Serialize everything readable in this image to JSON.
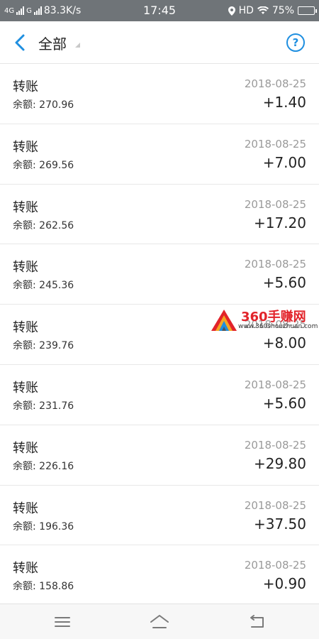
{
  "status_bar": {
    "network_1": "4G",
    "network_2": "G",
    "speed": "83.3K/s",
    "time": "17:45",
    "hd": "HD",
    "battery": "75%",
    "battery_level": 0.75
  },
  "header": {
    "title": "全部",
    "help_symbol": "?",
    "accent_color": "#1f8fe0"
  },
  "transactions": [
    {
      "title": "转账",
      "balance": "余额: 270.96",
      "date": "2018-08-25",
      "amount": "+1.40"
    },
    {
      "title": "转账",
      "balance": "余额: 269.56",
      "date": "2018-08-25",
      "amount": "+7.00"
    },
    {
      "title": "转账",
      "balance": "余额: 262.56",
      "date": "2018-08-25",
      "amount": "+17.20"
    },
    {
      "title": "转账",
      "balance": "余额: 245.36",
      "date": "2018-08-25",
      "amount": "+5.60"
    },
    {
      "title": "转账",
      "balance": "余额: 239.76",
      "date": "2018-08-25",
      "amount": "+8.00"
    },
    {
      "title": "转账",
      "balance": "余额: 231.76",
      "date": "2018-08-25",
      "amount": "+5.60"
    },
    {
      "title": "转账",
      "balance": "余额: 226.16",
      "date": "2018-08-25",
      "amount": "+29.80"
    },
    {
      "title": "转账",
      "balance": "余额: 196.36",
      "date": "2018-08-25",
      "amount": "+37.50"
    },
    {
      "title": "转账",
      "balance": "余额: 158.86",
      "date": "2018-08-25",
      "amount": "+0.90"
    }
  ],
  "watermark": {
    "name": "360手赚网",
    "url": "www.360shouzhuan.com"
  },
  "nav_icons": [
    "menu-icon",
    "home-icon",
    "back-return-icon"
  ]
}
